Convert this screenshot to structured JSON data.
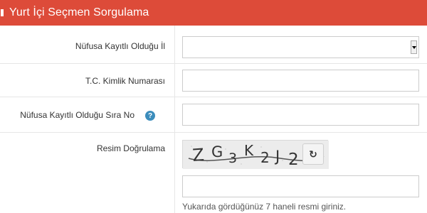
{
  "header": {
    "title": "Yurt İçi Seçmen Sorgulama",
    "color": "#dd4b39"
  },
  "form": {
    "province_label": "Nüfusa Kayıtlı Olduğu İl",
    "province_value": "",
    "tc_label": "T.C. Kimlik Numarası",
    "tc_value": "",
    "sira_label": "Nüfusa Kayıtlı Olduğu Sıra No",
    "sira_value": "",
    "captcha_label": "Resim Doğrulama",
    "captcha_text": "ZG3K2J2",
    "captcha_value": "",
    "captcha_hint": "Yukarıda gördüğünüz 7 haneli resmi giriniz."
  },
  "icons": {
    "help": "question-circle-icon",
    "refresh": "refresh-icon",
    "dropdown": "chevron-down-icon"
  }
}
